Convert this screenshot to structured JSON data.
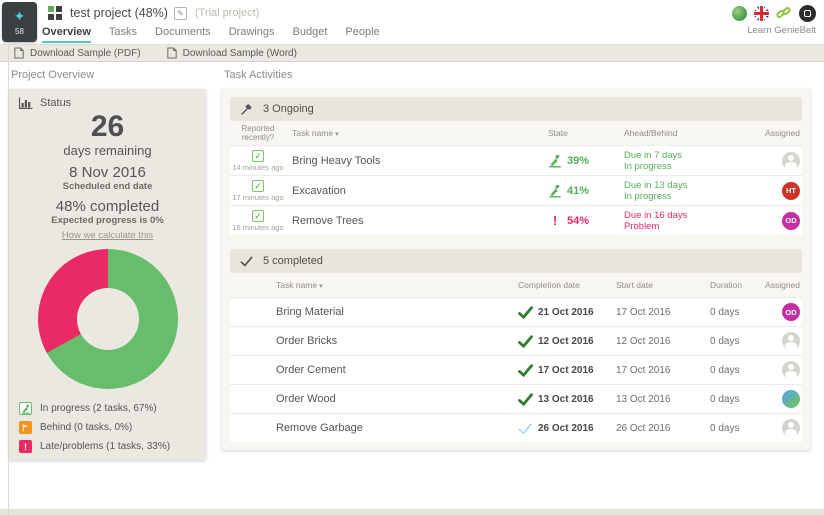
{
  "colors": {
    "accent_teal": "#55c6cc",
    "green": "#68bd6c",
    "dark_green_check": "#2f7d33",
    "pink": "#ea2a64",
    "orange": "#f2951f",
    "blue": "#45b7da",
    "avatar_red": "#cc342a",
    "avatar_magenta": "#c32fa4",
    "card_beige": "#ebe8e1"
  },
  "chart_data": {
    "type": "pie",
    "donut": true,
    "title": "Status",
    "labels": [
      "In progress",
      "Behind",
      "Late/problems"
    ],
    "values": [
      67,
      0,
      33
    ],
    "colors": [
      "#68bd6c",
      "#f2951f",
      "#ea2a64"
    ],
    "annotations": [
      "26 days remaining",
      "8 Nov 2016 Scheduled end date",
      "48% completed",
      "Expected progress is 0%"
    ]
  },
  "header": {
    "badge": "58",
    "project_title": "test project (48%)",
    "trial_label": "(Trial project)",
    "learn_link": "Learn GenieBelt",
    "tabs": [
      {
        "label": "Overview"
      },
      {
        "label": "Tasks"
      },
      {
        "label": "Documents"
      },
      {
        "label": "Drawings"
      },
      {
        "label": "Budget"
      },
      {
        "label": "People"
      }
    ]
  },
  "toolbar": {
    "download_pdf": "Download Sample (PDF)",
    "download_word": "Download Sample (Word)"
  },
  "overview": {
    "section_title": "Project Overview",
    "card_title": "Status",
    "days_value": "26",
    "days_label": "days remaining",
    "end_date": "8 Nov 2016",
    "end_date_label": "Scheduled end date",
    "completed_text": "48% completed",
    "expected_text": "Expected progress is 0%",
    "calc_link": "How we calculate this",
    "legend": [
      {
        "label": "In progress (2 tasks, 67%)"
      },
      {
        "label": "Behind (0 tasks, 0%)"
      },
      {
        "label": "Late/problems (1 tasks, 33%)"
      }
    ]
  },
  "tasks": {
    "section_title": "Task Activities",
    "ongoing": {
      "header": "3 Ongoing",
      "col_reported": "Reported recently?",
      "col_name": "Task name",
      "col_state": "State",
      "col_ahead": "Ahead/Behind",
      "col_assigned": "Assigned",
      "rows": [
        {
          "reported": "14 minutes ago",
          "name": "Bring Heavy Tools",
          "progress": "39%",
          "due": "Due in 7 days",
          "status": "In progress",
          "assignee": ""
        },
        {
          "reported": "17 minutes ago",
          "name": "Excavation",
          "progress": "41%",
          "due": "Due in 13 days",
          "status": "In progress",
          "assignee": "HT"
        },
        {
          "reported": "16 minutes ago",
          "name": "Remove Trees",
          "progress": "54%",
          "due": "Due in 16 days",
          "status": "Problem",
          "assignee": "OD"
        }
      ]
    },
    "completed": {
      "header": "5 completed",
      "col_name": "Task name",
      "col_completion": "Completion date",
      "col_start": "Start date",
      "col_duration": "Duration",
      "col_assigned": "Assigned",
      "rows": [
        {
          "name": "Bring Material",
          "completion": "21 Oct 2016",
          "start": "17 Oct 2016",
          "duration": "0 days",
          "assignee": "OD"
        },
        {
          "name": "Order Bricks",
          "completion": "12 Oct 2016",
          "start": "12 Oct 2016",
          "duration": "0 days",
          "assignee": ""
        },
        {
          "name": "Order Cement",
          "completion": "17 Oct 2016",
          "start": "17 Oct 2016",
          "duration": "0 days",
          "assignee": ""
        },
        {
          "name": "Order Wood",
          "completion": "13 Oct 2016",
          "start": "13 Oct 2016",
          "duration": "0 days",
          "assignee": ""
        },
        {
          "name": "Remove Garbage",
          "completion": "26 Oct 2016",
          "start": "26 Oct 2016",
          "duration": "0 days",
          "assignee": ""
        }
      ]
    }
  }
}
